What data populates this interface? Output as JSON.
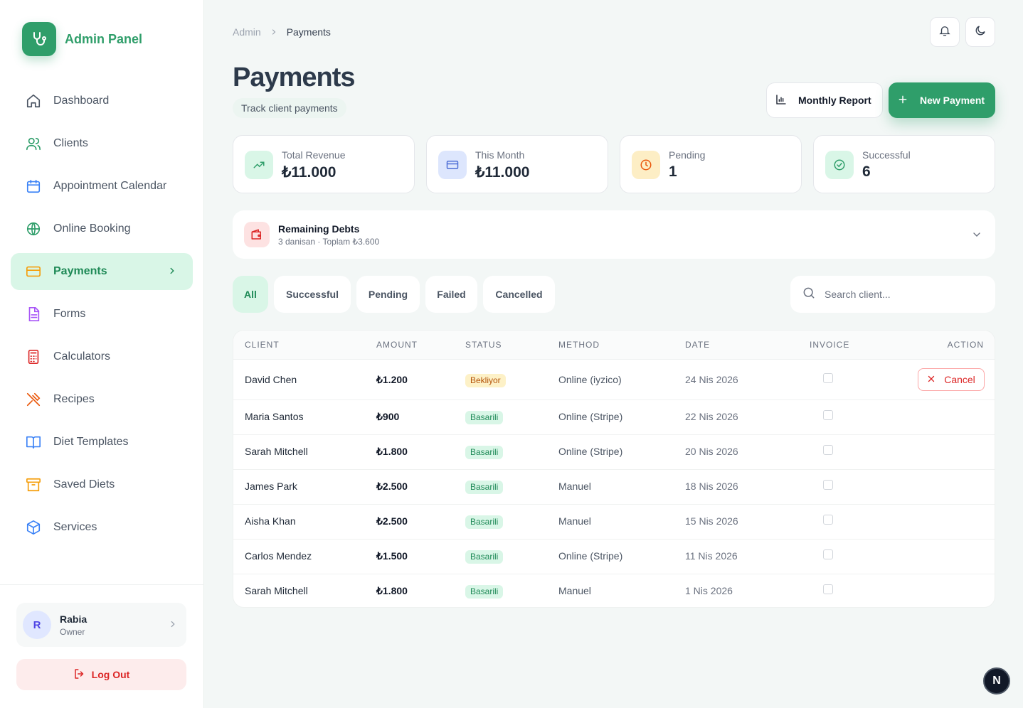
{
  "brand": {
    "title": "Admin Panel",
    "icon": "stethoscope-icon"
  },
  "sidebar": {
    "items": [
      {
        "label": "Dashboard",
        "icon": "home-icon"
      },
      {
        "label": "Clients",
        "icon": "users-icon"
      },
      {
        "label": "Appointment Calendar",
        "icon": "calendar-icon"
      },
      {
        "label": "Online Booking",
        "icon": "globe-icon"
      },
      {
        "label": "Payments",
        "icon": "credit-card-icon",
        "active": true
      },
      {
        "label": "Forms",
        "icon": "document-icon"
      },
      {
        "label": "Calculators",
        "icon": "calculator-icon"
      },
      {
        "label": "Recipes",
        "icon": "utensils-icon"
      },
      {
        "label": "Diet Templates",
        "icon": "book-icon"
      },
      {
        "label": "Saved Diets",
        "icon": "archive-icon"
      },
      {
        "label": "Services",
        "icon": "package-icon"
      }
    ],
    "user": {
      "initial": "R",
      "name": "Rabia",
      "role": "Owner"
    },
    "logout_label": "Log Out"
  },
  "header": {
    "breadcrumb": [
      "Admin",
      "Payments"
    ],
    "title": "Payments",
    "subtitle": "Track client payments",
    "report_label": "Monthly Report",
    "new_label": "New Payment"
  },
  "stats": [
    {
      "label": "Total Revenue",
      "value": "₺11.000",
      "icon": "trending-up-icon",
      "color": "#2f9e6a"
    },
    {
      "label": "This Month",
      "value": "₺11.000",
      "icon": "credit-card-icon",
      "color": "#4f6fd6"
    },
    {
      "label": "Pending",
      "value": "1",
      "icon": "clock-icon",
      "color": "#ea580c"
    },
    {
      "label": "Successful",
      "value": "6",
      "icon": "check-circle-icon",
      "color": "#2f9e6a"
    }
  ],
  "debts": {
    "title": "Remaining Debts",
    "subtitle": "3 danisan · Toplam ₺3.600"
  },
  "filters": {
    "tabs": [
      "All",
      "Successful",
      "Pending",
      "Failed",
      "Cancelled"
    ],
    "active": "All",
    "search_placeholder": "Search client..."
  },
  "table": {
    "columns": [
      "CLIENT",
      "AMOUNT",
      "STATUS",
      "METHOD",
      "DATE",
      "INVOICE",
      "ACTION"
    ],
    "rows": [
      {
        "client": "David Chen",
        "amount": "₺1.200",
        "status": "Bekliyor",
        "method": "Online (iyzico)",
        "date": "24 Nis 2026",
        "action": "Cancel"
      },
      {
        "client": "Maria Santos",
        "amount": "₺900",
        "status": "Basarili",
        "method": "Online (Stripe)",
        "date": "22 Nis 2026",
        "action": ""
      },
      {
        "client": "Sarah Mitchell",
        "amount": "₺1.800",
        "status": "Basarili",
        "method": "Online (Stripe)",
        "date": "20 Nis 2026",
        "action": ""
      },
      {
        "client": "James Park",
        "amount": "₺2.500",
        "status": "Basarili",
        "method": "Manuel",
        "date": "18 Nis 2026",
        "action": ""
      },
      {
        "client": "Aisha Khan",
        "amount": "₺2.500",
        "status": "Basarili",
        "method": "Manuel",
        "date": "15 Nis 2026",
        "action": ""
      },
      {
        "client": "Carlos Mendez",
        "amount": "₺1.500",
        "status": "Basarili",
        "method": "Online (Stripe)",
        "date": "11 Nis 2026",
        "action": ""
      },
      {
        "client": "Sarah Mitchell",
        "amount": "₺1.800",
        "status": "Basarili",
        "method": "Manuel",
        "date": "1 Nis 2026",
        "action": ""
      }
    ]
  },
  "dev_badge": "N"
}
